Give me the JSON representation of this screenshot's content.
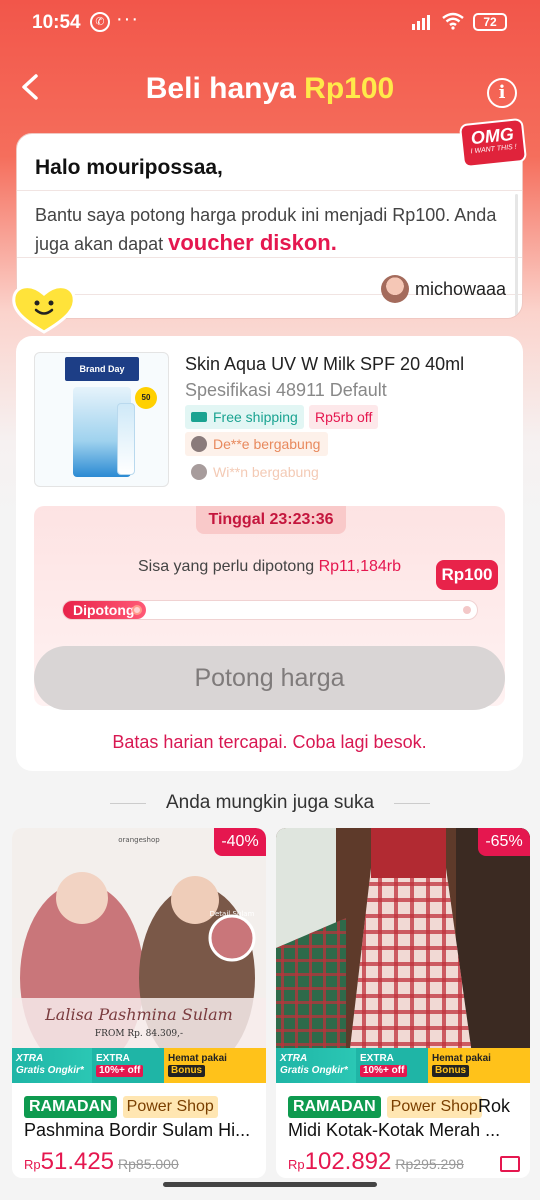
{
  "status_bar": {
    "time": "10:54",
    "more": "···",
    "battery": "72"
  },
  "header": {
    "title_prefix": "Beli hanya ",
    "title_price": "Rp100",
    "back_icon": "chevron-left-icon",
    "info_icon": "info-icon"
  },
  "message": {
    "greeting": "Halo mouripossaa,",
    "body_prefix": "Bantu saya potong harga produk ini menjadi Rp100. Anda juga akan dapat ",
    "voucher_text": "voucher diskon.",
    "body_suffix": ".",
    "sender": "michowaaa",
    "sticker_big": "OMG",
    "sticker_small": "I WANT THIS !"
  },
  "product": {
    "title": "Skin Aqua UV W Milk SPF 20 40ml",
    "spec": "Spesifikasi 48911 Default",
    "free_shipping": "Free shipping",
    "discount_tag": "Rp5rb off",
    "image_badge": "Brand Day",
    "image_spf": "50",
    "joiners": [
      "De**e bergabung",
      "Wi**n bergabung"
    ]
  },
  "cut": {
    "timer": "Tinggal 23:23:36",
    "remaining_label": "Sisa yang perlu dipotong ",
    "remaining_amount": "Rp11,184rb",
    "target": "Rp100",
    "progress_label": "Dipotong",
    "progress_fraction": 0.2,
    "button_label": "Potong harga",
    "limit_message": "Batas harian tercapai. Coba lagi besok."
  },
  "recommend": {
    "title": "Anda mungkin juga suka",
    "items": [
      {
        "discount": "-40%",
        "promo_xtra": "XTRA",
        "promo_xtra_sub": "Gratis Ongkir*",
        "promo_extra": "EXTRA",
        "promo_extra_sub": "10%+ off",
        "promo_hemat": "Hemat pakai",
        "promo_hemat_sub": "Bonus",
        "badge_ramadan": "RAMADAN",
        "badge_shop": "Power Shop",
        "name": "Pashmina Bordir Sulam Hi...",
        "currency": "Rp",
        "price": "51.425",
        "old_price": "Rp85.000",
        "image_caption": "Lalisa Pashmina Sulam",
        "image_from": "FROM Rp. 84.309,-",
        "image_brand": "orangeshop",
        "image_detail": "Detail Sulam"
      },
      {
        "discount": "-65%",
        "promo_xtra": "XTRA",
        "promo_xtra_sub": "Gratis Ongkir*",
        "promo_extra": "EXTRA",
        "promo_extra_sub": "10%+ off",
        "promo_hemat": "Hemat pakai",
        "promo_hemat_sub": "Bonus",
        "badge_ramadan": "RAMADAN",
        "badge_shop": "Power Shop",
        "name_inline": "Rok",
        "name": "Midi Kotak-Kotak Merah ...",
        "currency": "Rp",
        "price": "102.892",
        "old_price": "Rp295.298"
      }
    ]
  },
  "colors": {
    "brand_red": "#f2564a",
    "accent_pink": "#e5174f",
    "price_yellow": "#ffe94a"
  }
}
